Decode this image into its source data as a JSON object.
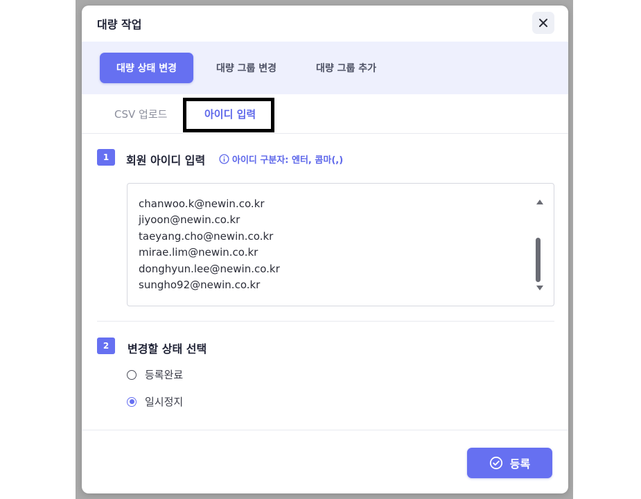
{
  "modal": {
    "title": "대량 작업",
    "close_icon": "close-icon"
  },
  "segments": [
    {
      "label": "대량 상태 변경",
      "active": true
    },
    {
      "label": "대량 그룹 변경",
      "active": false
    },
    {
      "label": "대량 그룹 추가",
      "active": false
    }
  ],
  "tabs": [
    {
      "label": "CSV 업로드",
      "active": false
    },
    {
      "label": "아이디 입력",
      "active": true
    }
  ],
  "step1": {
    "number": "1",
    "title": "회원 아이디 입력",
    "hint": "아이디 구분자: 엔터, 콤마(,)",
    "hint_icon": "info-icon",
    "ids": [
      "chanwoo.k@newin.co.kr",
      "jiyoon@newin.co.kr",
      "taeyang.cho@newin.co.kr",
      "mirae.lim@newin.co.kr",
      "donghyun.lee@newin.co.kr",
      "sungho92@newin.co.kr"
    ]
  },
  "step2": {
    "number": "2",
    "title": "변경할 상태 선택",
    "options": [
      {
        "label": "등록완료",
        "checked": false
      },
      {
        "label": "일시정지",
        "checked": true
      }
    ]
  },
  "footer": {
    "submit_label": "등록",
    "submit_icon": "check-circle-icon"
  },
  "colors": {
    "accent": "#6670f1",
    "segment_bar_bg": "#eef0fd",
    "backdrop": "#a9a9a9"
  }
}
